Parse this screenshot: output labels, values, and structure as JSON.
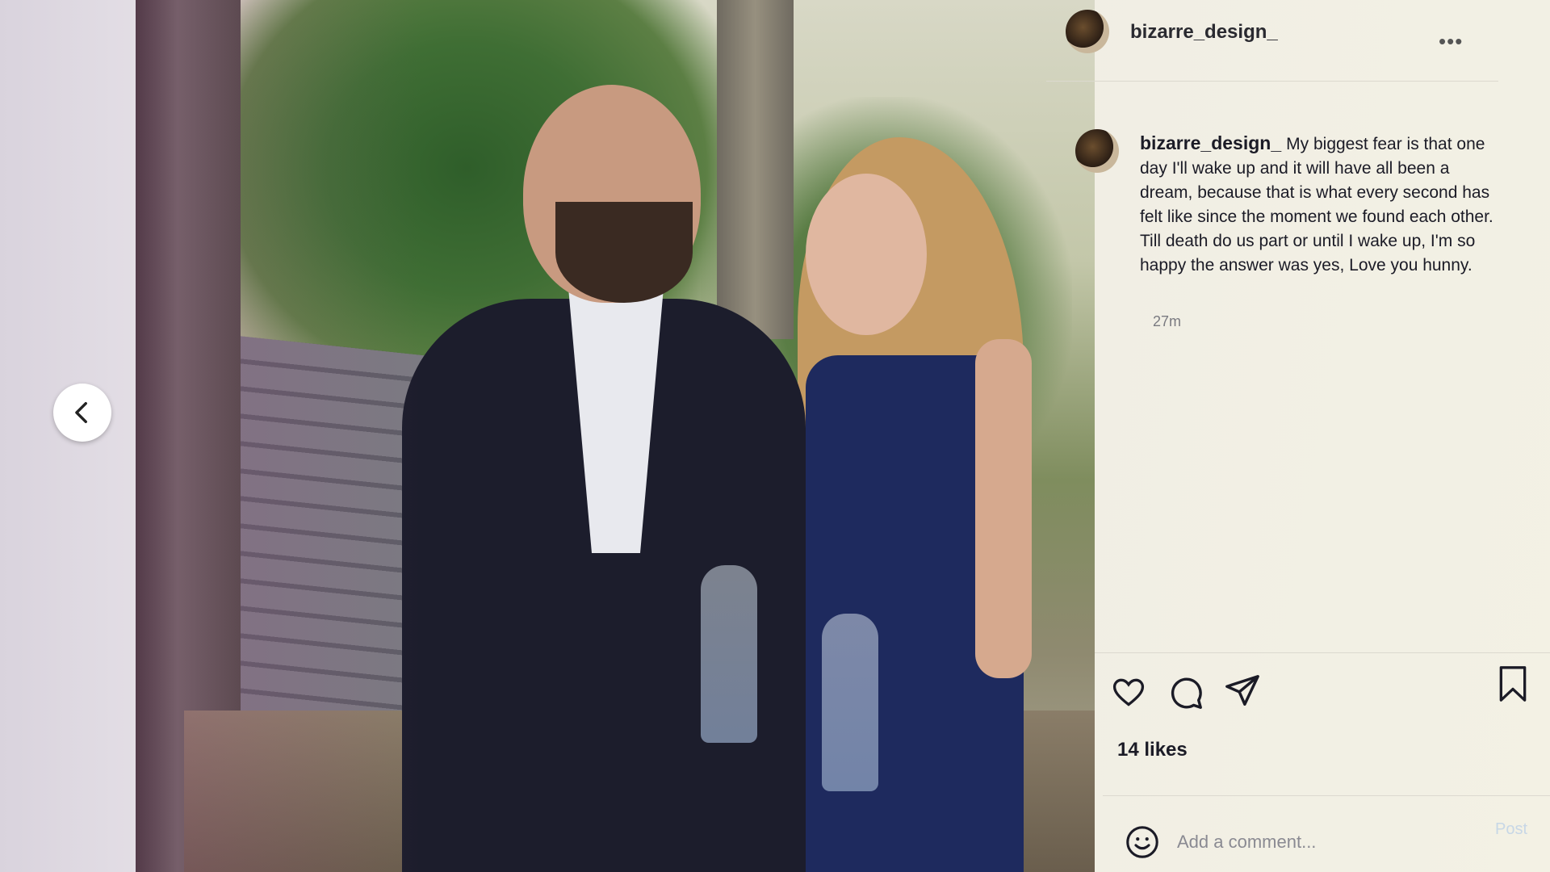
{
  "post": {
    "username": "bizarre_design_",
    "more_label": "•••",
    "caption_username": "bizarre_design_",
    "caption_text": "My biggest fear is that one day I'll wake up and it will have all been a dream, because that is what every second has felt like since the moment we found each other. Till death do us part or until I wake up, I'm so happy the answer was yes, Love you hunny.",
    "timestamp": "27m",
    "likes": "14 likes"
  },
  "comment": {
    "placeholder": "Add a comment...",
    "post_label": "Post"
  },
  "icons": {
    "back": "chevron-left-icon",
    "like": "heart-icon",
    "comment": "comment-bubble-icon",
    "share": "paper-plane-icon",
    "save": "bookmark-icon",
    "emoji": "smiley-icon",
    "more": "more-dots-icon"
  },
  "colors": {
    "text": "#1b1b26",
    "muted": "#7a7a80",
    "post_disabled": "#c7d7e6"
  }
}
